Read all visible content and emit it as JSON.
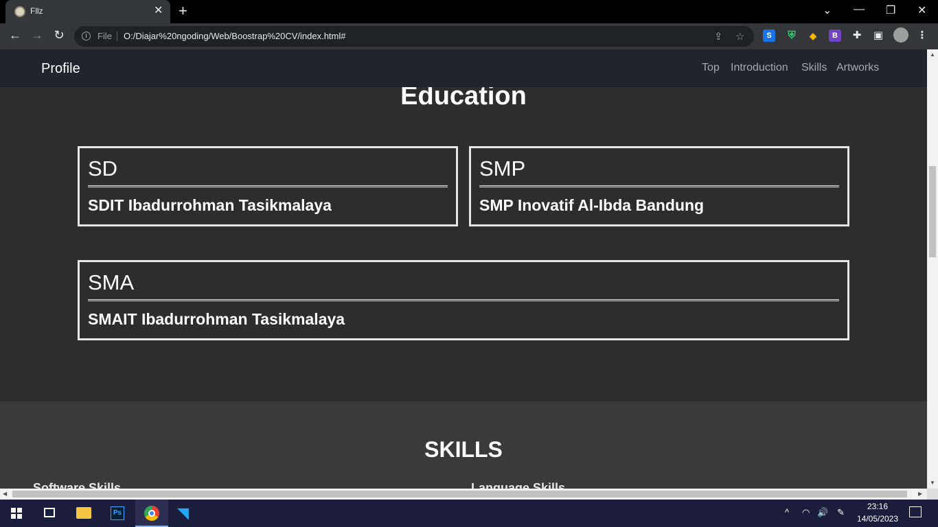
{
  "browser": {
    "tab_title": "Fllz",
    "tab_close": "✕",
    "new_tab": "+",
    "file_label": "File",
    "url": "O:/Diajar%20ngoding/Web/Boostrap%20CV/index.html#"
  },
  "navbar": {
    "brand": "Profile",
    "links": [
      "Top",
      "Introduction",
      "Skills",
      "Artworks"
    ]
  },
  "education": {
    "title": "Education",
    "cards": [
      {
        "level": "SD",
        "school": "SDIT Ibadurrohman Tasikmalaya"
      },
      {
        "level": "SMP",
        "school": "SMP Inovatif Al-Ibda Bandung"
      },
      {
        "level": "SMA",
        "school": "SMAIT Ibadurrohman Tasikmalaya"
      }
    ]
  },
  "skills": {
    "title": "SKILLS",
    "software_heading": "Software Skills",
    "language_heading": "Language Skills"
  },
  "taskbar": {
    "time": "23:16",
    "date": "14/05/2023"
  },
  "colors": {
    "navbar_bg": "#212529",
    "page_bg": "#2d2d2d",
    "skills_bg": "#3a3a3a",
    "taskbar_bg": "#1b1d3c"
  }
}
